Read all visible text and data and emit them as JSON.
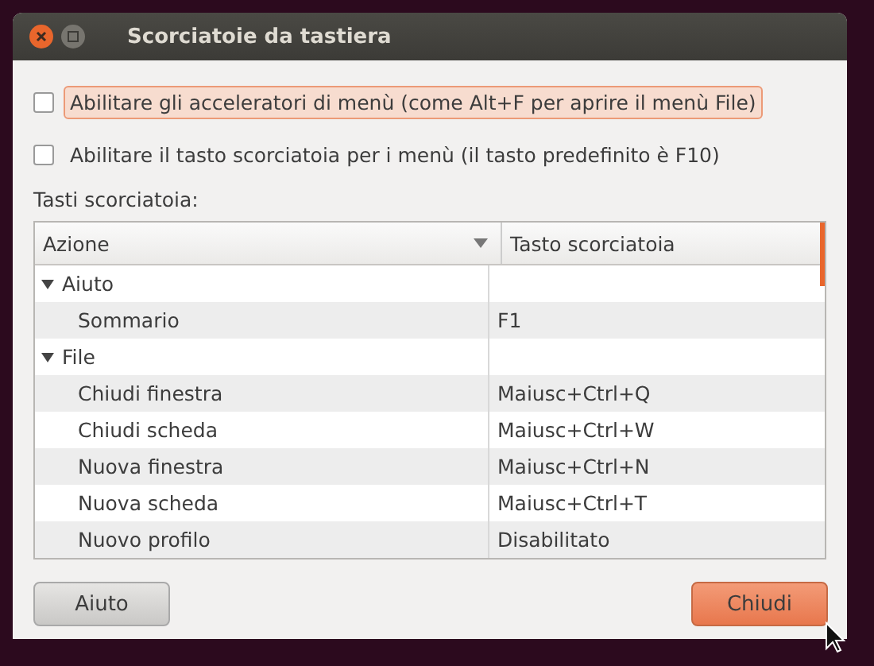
{
  "window": {
    "title": "Scorciatoie da tastiera"
  },
  "options": [
    {
      "label": "Abilitare gli acceleratori di menù (come Alt+F per aprire il menù File)",
      "checked": false,
      "focused": true
    },
    {
      "label": "Abilitare il tasto scorciatoia per i menù (il tasto predefinito è F10)",
      "checked": false,
      "focused": false
    }
  ],
  "section_label": "Tasti scorciatoia:",
  "table": {
    "columns": [
      "Azione",
      "Tasto scorciatoia"
    ],
    "rows": [
      {
        "action": "Aiuto",
        "expanded": true,
        "children": [
          {
            "action": "Sommario",
            "shortcut": "F1"
          }
        ]
      },
      {
        "action": "File",
        "expanded": true,
        "children": [
          {
            "action": "Chiudi finestra",
            "shortcut": "Maiusc+Ctrl+Q"
          },
          {
            "action": "Chiudi scheda",
            "shortcut": "Maiusc+Ctrl+W"
          },
          {
            "action": "Nuova finestra",
            "shortcut": "Maiusc+Ctrl+N"
          },
          {
            "action": "Nuova scheda",
            "shortcut": "Maiusc+Ctrl+T"
          },
          {
            "action": "Nuovo profilo",
            "shortcut": "Disabilitato"
          }
        ]
      }
    ]
  },
  "buttons": [
    {
      "label": "Aiuto",
      "default": false
    },
    {
      "label": "Chiudi",
      "default": true
    }
  ]
}
